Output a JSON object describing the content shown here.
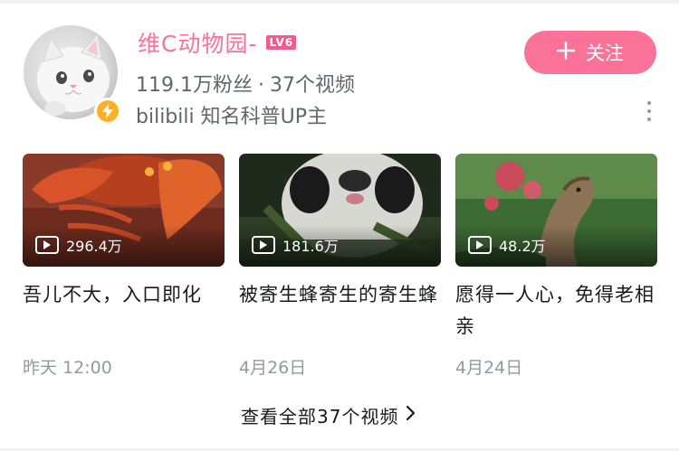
{
  "profile": {
    "name": "维C动物园-",
    "level": "LV6",
    "stats": {
      "fans": "119.1万粉丝",
      "separator": "·",
      "videos": "37个视频"
    },
    "description": "bilibili 知名科普UP主"
  },
  "follow_button": {
    "label": "关注",
    "icon": "plus-icon"
  },
  "videos": [
    {
      "views": "296.4万",
      "title": "吾儿不大，入口即化",
      "date": "昨天 12:00"
    },
    {
      "views": "181.6万",
      "title": "被寄生蜂寄生的寄生蜂",
      "date": "4月26日"
    },
    {
      "views": "48.2万",
      "title": "愿得一人心，免得老相亲",
      "date": "4月24日"
    }
  ],
  "view_all": {
    "label": "查看全部37个视频",
    "icon": "chevron-right-icon"
  },
  "colors": {
    "accent": "#fb7299",
    "level_badge": "#f45a8d",
    "verified": "#ffb027",
    "muted_text": "#9499a0"
  }
}
